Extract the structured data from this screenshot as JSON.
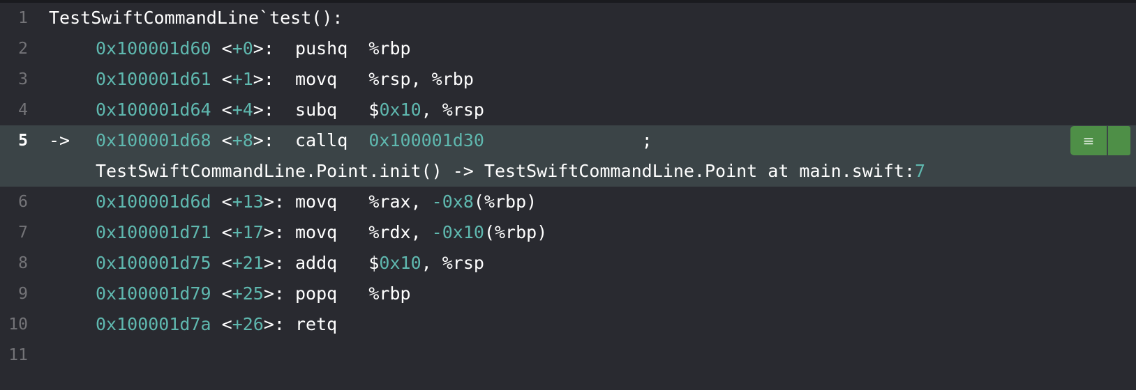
{
  "editor": {
    "colors": {
      "background": "#292a30",
      "number": "#5fb8af",
      "highlight": "#3b4447",
      "badge": "#4e8f47"
    },
    "header": "TestSwiftCommandLine`test():",
    "current_arrow": "->",
    "instructions": [
      {
        "line": "2",
        "addr": "0x100001d60",
        "off": "+0",
        "sep": ">:  ",
        "op": "pushq  ",
        "args": [
          [
            "%rbp",
            "p"
          ]
        ]
      },
      {
        "line": "3",
        "addr": "0x100001d61",
        "off": "+1",
        "sep": ">:  ",
        "op": "movq   ",
        "args": [
          [
            "%rsp, %rbp",
            "p"
          ]
        ]
      },
      {
        "line": "4",
        "addr": "0x100001d64",
        "off": "+4",
        "sep": ">:  ",
        "op": "subq   ",
        "args": [
          [
            "$",
            "p"
          ],
          [
            "0x10",
            "n"
          ],
          [
            ", %rsp",
            "p"
          ]
        ]
      },
      {
        "line": "5",
        "addr": "0x100001d68",
        "off": "+8",
        "sep": ">:  ",
        "op": "callq  ",
        "call_target": "0x100001d30",
        "comment": ";",
        "continuation_text": "TestSwiftCommandLine.Point.init() -> TestSwiftCommandLine.Point at main.swift:",
        "continuation_line": "7"
      },
      {
        "line": "6",
        "addr": "0x100001d6d",
        "off": "+13",
        "sep": ">: ",
        "op": "movq   ",
        "args": [
          [
            "%rax, ",
            "p"
          ],
          [
            "-0x8",
            "n"
          ],
          [
            "(%rbp)",
            "p"
          ]
        ]
      },
      {
        "line": "7",
        "addr": "0x100001d71",
        "off": "+17",
        "sep": ">: ",
        "op": "movq   ",
        "args": [
          [
            "%rdx, ",
            "p"
          ],
          [
            "-0x10",
            "n"
          ],
          [
            "(%rbp)",
            "p"
          ]
        ]
      },
      {
        "line": "8",
        "addr": "0x100001d75",
        "off": "+21",
        "sep": ">: ",
        "op": "addq   ",
        "args": [
          [
            "$",
            "p"
          ],
          [
            "0x10",
            "n"
          ],
          [
            ", %rsp",
            "p"
          ]
        ]
      },
      {
        "line": "9",
        "addr": "0x100001d79",
        "off": "+25",
        "sep": ">: ",
        "op": "popq   ",
        "args": [
          [
            "%rbp",
            "p"
          ]
        ]
      },
      {
        "line": "10",
        "addr": "0x100001d7a",
        "off": "+26",
        "sep": ">: ",
        "op": "retq",
        "args": []
      }
    ],
    "line_numbers": {
      "first": "1",
      "last": "11"
    },
    "badge": {
      "icon": "list-icon",
      "glyph": "≡"
    }
  }
}
